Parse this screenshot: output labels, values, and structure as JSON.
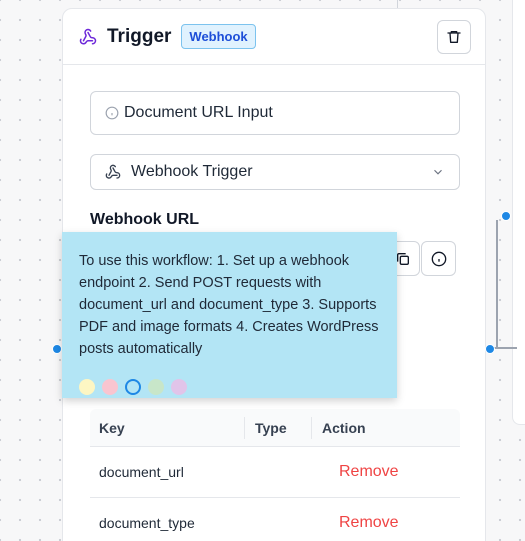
{
  "node": {
    "title": "Trigger",
    "badge": "Webhook",
    "name_input_value": "Document URL Input",
    "trigger_select_value": "Webhook Trigger",
    "webhook_url_label": "Webhook URL"
  },
  "table": {
    "headers": {
      "key": "Key",
      "type": "Type",
      "action": "Action"
    },
    "rows": [
      {
        "key": "document_url",
        "type": "",
        "action": "Remove"
      },
      {
        "key": "document_type",
        "type": "",
        "action": "Remove"
      }
    ]
  },
  "sticky_note": {
    "text": "To use this workflow: 1. Set up a webhook endpoint 2. Send POST requests with document_url and document_type 3. Supports PDF and image formats 4. Creates WordPress posts automatically",
    "colors": [
      "#fdf6c3",
      "#f9c5d0",
      "#b3e5f5",
      "#c8e6c9",
      "#e1c4e9"
    ],
    "selected_color": "#b3e5f5"
  },
  "icons": {
    "header": "webhook-icon",
    "delete": "trash-icon",
    "info": "info-icon",
    "select": "webhook-icon",
    "dropdown": "chevron-down-icon",
    "copy": "copy-icon"
  }
}
